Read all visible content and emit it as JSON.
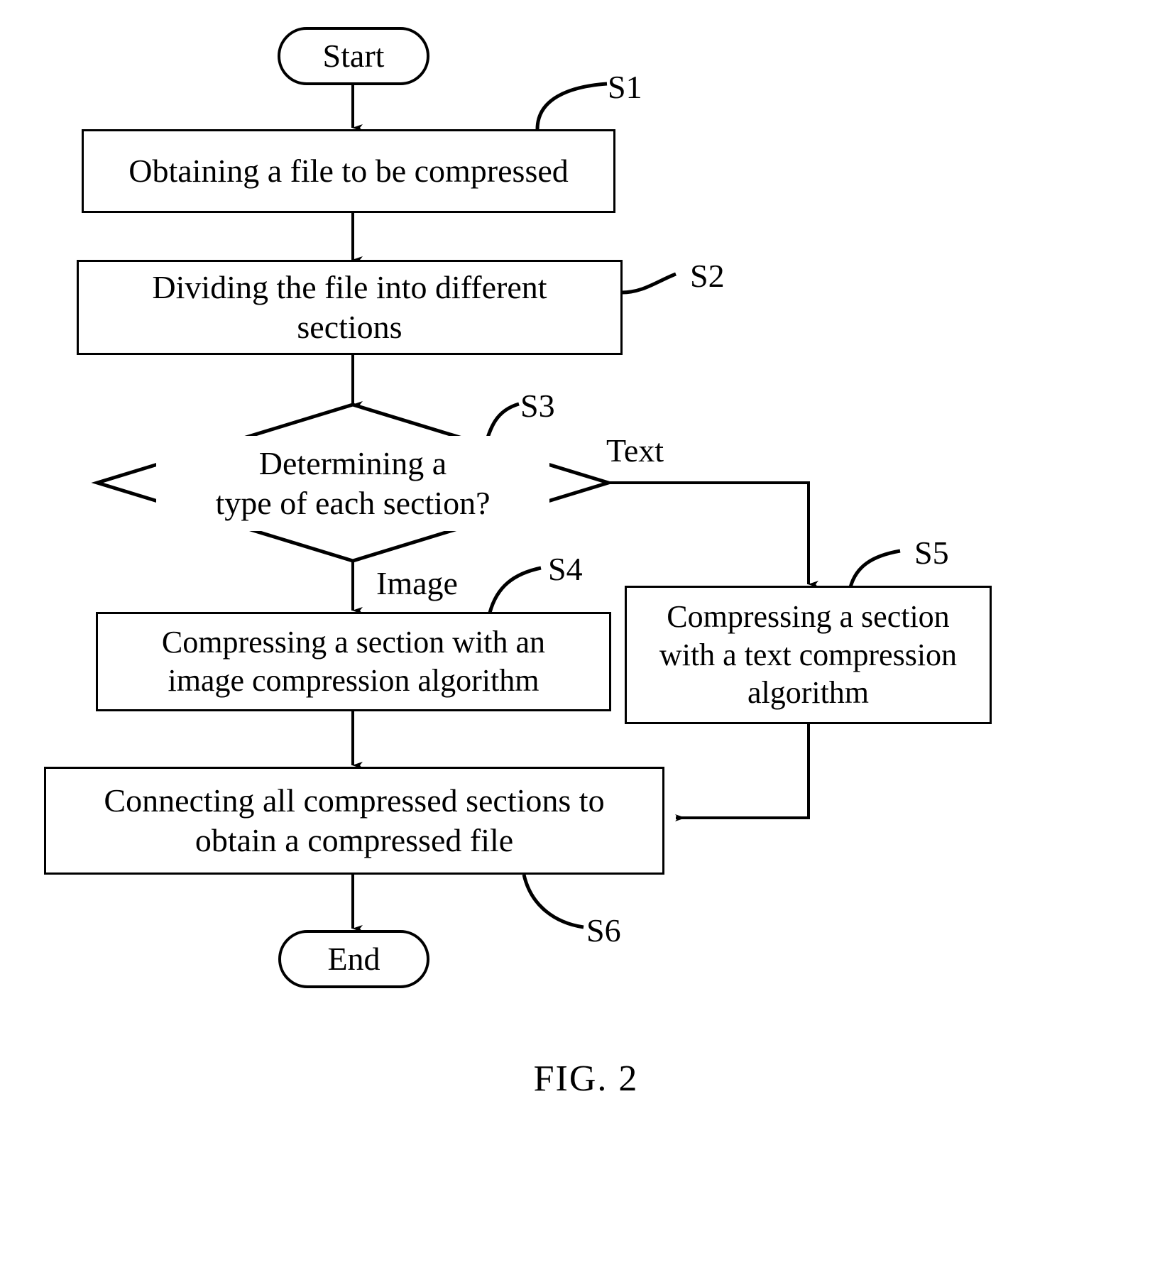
{
  "figure": {
    "caption": "FIG. 2",
    "kind": "flowchart"
  },
  "nodes": {
    "start": {
      "label": "Start",
      "shape": "terminator"
    },
    "s1": {
      "label": "Obtaining a file to be compressed",
      "step_id": "S1",
      "shape": "process"
    },
    "s2": {
      "label": "Dividing the file into different\nsections",
      "step_id": "S2",
      "shape": "process"
    },
    "s3": {
      "label": "Determining a\ntype of each section?",
      "step_id": "S3",
      "shape": "decision"
    },
    "s4": {
      "label": "Compressing a section with an\nimage compression algorithm",
      "step_id": "S4",
      "shape": "process"
    },
    "s5": {
      "label": "Compressing a section\nwith a text compression\nalgorithm",
      "step_id": "S5",
      "shape": "process"
    },
    "s6": {
      "label": "Connecting all compressed sections to\nobtain a compressed file",
      "step_id": "S6",
      "shape": "process"
    },
    "end": {
      "label": "End",
      "shape": "terminator"
    }
  },
  "branch_labels": {
    "text": "Text",
    "image": "Image"
  },
  "colors": {
    "stroke": "#000000",
    "fill": "#ffffff",
    "text": "#000000"
  }
}
